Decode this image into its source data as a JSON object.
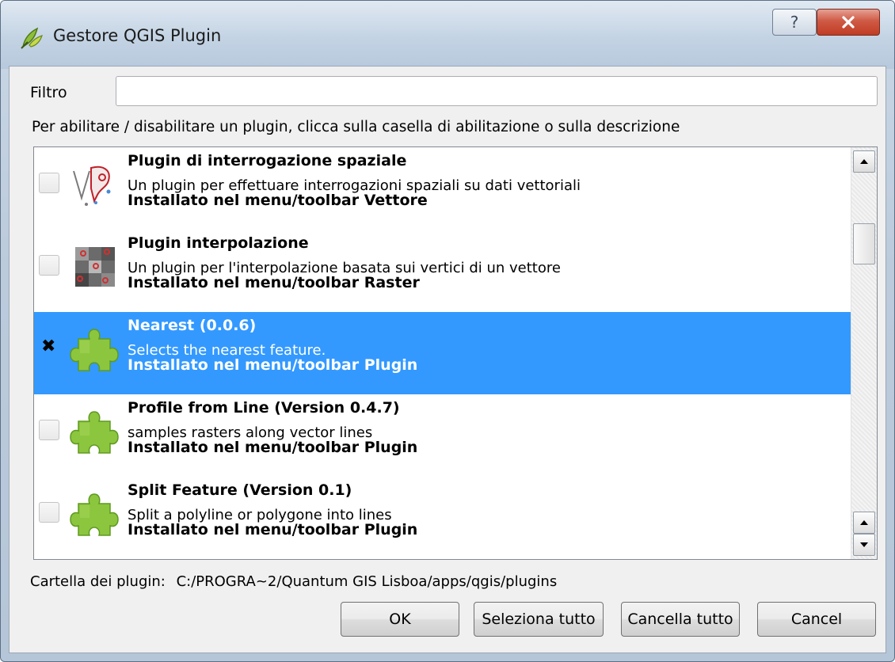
{
  "window": {
    "title": "Gestore QGIS Plugin"
  },
  "filter": {
    "label": "Filtro",
    "value": ""
  },
  "instructions": "Per abilitare / disabilitare un plugin, clicca sulla casella di abilitazione o sulla descrizione",
  "plugins": [
    {
      "title": "Plugin di interrogazione spaziale",
      "description": "Un plugin per effettuare interrogazioni spaziali su dati vettoriali",
      "installed": "Installato nel menu/toolbar Vettore",
      "checked": false,
      "selected": false,
      "icon": "spatial-query-icon"
    },
    {
      "title": "Plugin interpolazione",
      "description": "Un plugin per l'interpolazione basata sui vertici di un vettore",
      "installed": "Installato nel menu/toolbar Raster",
      "checked": false,
      "selected": false,
      "icon": "interpolation-icon"
    },
    {
      "title": "Nearest (0.0.6)",
      "description": "Selects the nearest feature.",
      "installed": "Installato nel menu/toolbar Plugin",
      "checked": true,
      "selected": true,
      "icon": "puzzle-plugin-icon"
    },
    {
      "title": "Profile from Line (Version 0.4.7)",
      "description": "samples rasters along vector lines",
      "installed": "Installato nel menu/toolbar Plugin",
      "checked": false,
      "selected": false,
      "icon": "puzzle-plugin-icon"
    },
    {
      "title": "Split Feature (Version 0.1)",
      "description": "Split a polyline or polygone into lines",
      "installed": "Installato nel menu/toolbar Plugin",
      "checked": false,
      "selected": false,
      "icon": "puzzle-plugin-icon"
    }
  ],
  "plugin_folder": {
    "label": "Cartella dei plugin:",
    "path": "C:/PROGRA~2/Quantum GIS Lisboa/apps/qgis/plugins"
  },
  "buttons": {
    "ok": "OK",
    "select_all": "Seleziona tutto",
    "clear_all": "Cancella tutto",
    "cancel": "Cancel"
  },
  "colors": {
    "selection": "#3399ff",
    "close_button": "#c13c24"
  }
}
